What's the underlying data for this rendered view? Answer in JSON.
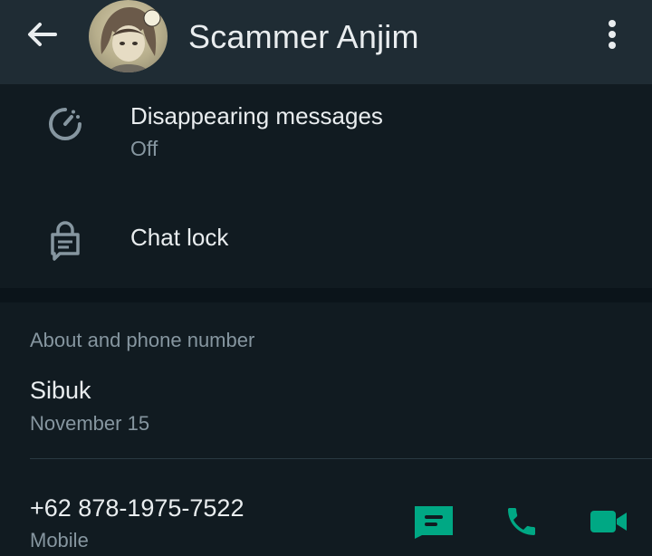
{
  "header": {
    "title": "Scammer Anjim",
    "back_icon": "arrow-left-icon",
    "menu_icon": "more-vertical-icon"
  },
  "settings": [
    {
      "icon": "timer-icon",
      "label": "Disappearing messages",
      "value": "Off"
    },
    {
      "icon": "lock-icon",
      "label": "Chat lock"
    }
  ],
  "about_section": {
    "header": "About and phone number",
    "about": "Sibuk",
    "date": "November 15",
    "phone": "+62 878-1975-7522",
    "phone_type": "Mobile",
    "actions": [
      {
        "icon": "message-icon"
      },
      {
        "icon": "phone-icon"
      },
      {
        "icon": "video-call-icon"
      }
    ]
  },
  "colors": {
    "background": "#111b21",
    "appbar": "#1f2c34",
    "accent": "#00a884",
    "secondary_text": "#8696a0",
    "primary_text": "#e9edef"
  }
}
